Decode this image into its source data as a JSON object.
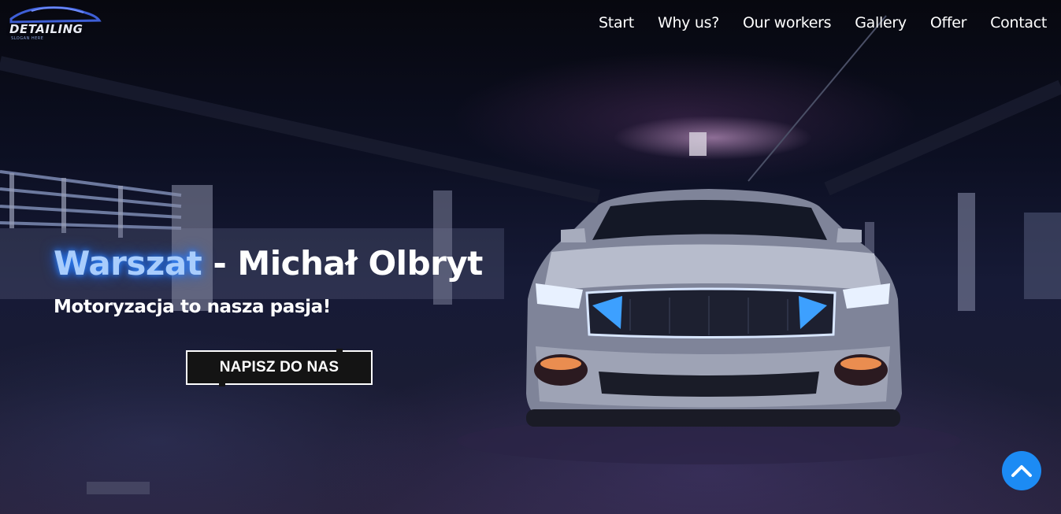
{
  "brand": {
    "logo_text": "DETAILING",
    "slogan": "SLOGAN HERE",
    "accent_color": "#1c8bf4",
    "logo_icon": "car-silhouette-icon"
  },
  "nav": {
    "items": [
      {
        "label": "Start"
      },
      {
        "label": "Why us?"
      },
      {
        "label": "Our workers"
      },
      {
        "label": "Gallery"
      },
      {
        "label": "Offer"
      },
      {
        "label": "Contact"
      }
    ]
  },
  "hero": {
    "title_accent": "Warszat",
    "title_rest": " - Michał Olbryt",
    "subtitle": "Motoryzacja to nasza pasja!",
    "cta_label": "NAPISZ DO NAS",
    "background_image": "sports-car-in-parking-garage"
  },
  "scroll_top": {
    "icon": "chevron-up-icon"
  }
}
